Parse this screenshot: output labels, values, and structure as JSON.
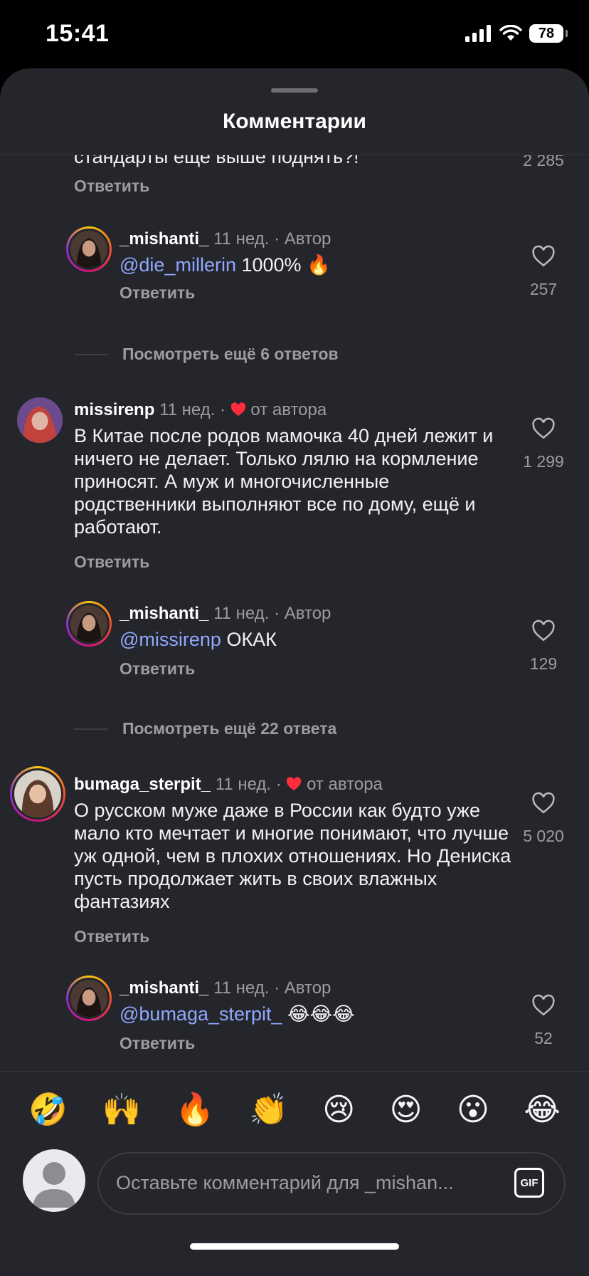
{
  "status": {
    "time": "15:41",
    "battery": "78"
  },
  "sheet": {
    "title": "Комментарии"
  },
  "comments": [
    {
      "kind": "partial",
      "text": "стандарты еще выше поднять?!",
      "likes": "2 285",
      "reply": "Ответить"
    },
    {
      "kind": "reply",
      "user": "_mishanti_",
      "time": "11 нед.",
      "tag": "Автор",
      "mention": "@die_millerin",
      "text": " 1000% 🔥",
      "likes": "257",
      "reply": "Ответить"
    },
    {
      "kind": "more",
      "label": "Посмотреть ещё 6 ответов"
    },
    {
      "kind": "top",
      "user": "missirenp",
      "time": "11 нед.",
      "tag": "от автора",
      "text": "В Китае после родов мамочка 40 дней лежит и ничего не делает. Только лялю на кормление приносят. А муж и многочисленные родственники выполняют все по дому, ещё и работают.",
      "likes": "1 299",
      "reply": "Ответить"
    },
    {
      "kind": "reply",
      "user": "_mishanti_",
      "time": "11 нед.",
      "tag": "Автор",
      "mention": "@missirenp",
      "text": " ОКАК",
      "likes": "129",
      "reply": "Ответить"
    },
    {
      "kind": "more",
      "label": "Посмотреть ещё 22 ответа"
    },
    {
      "kind": "top",
      "user": "bumaga_sterpit_",
      "time": "11 нед.",
      "tag": "от автора",
      "text": "О русском муже даже в России как будто уже мало кто мечтает и многие понимают, что лучше уж одной, чем в плохих отношениях. Но Дениска пусть продолжает жить в своих влажных фантазиях",
      "likes": "5 020",
      "reply": "Ответить"
    },
    {
      "kind": "reply",
      "user": "_mishanti_",
      "time": "11 нед.",
      "tag": "Автор",
      "mention": "@bumaga_sterpit_",
      "text": " 😂😂😂",
      "likes": "52",
      "reply": "Ответить"
    }
  ],
  "emojis": [
    "🤣",
    "🙌",
    "🔥",
    "👏",
    "😢",
    "😍",
    "😮",
    "😂"
  ],
  "composer": {
    "placeholder": "Оставьте комментарий для _mishan...",
    "gif_label": "GIF"
  },
  "icons": {
    "heart": "heart-outline-icon",
    "heart_red": "heart-filled-icon"
  },
  "colors": {
    "background": "#25262b",
    "mention": "#8ea8ff",
    "heart_red": "#ff2d3d"
  }
}
